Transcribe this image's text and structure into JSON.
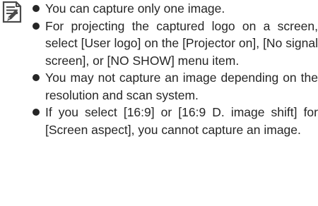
{
  "note": {
    "icon": "note-icon",
    "items": [
      "You can capture only one image.",
      "For projecting the captured logo on a screen, select [User logo] on the [Projector on], [No signal screen], or [NO SHOW] menu item.",
      "You may not capture an image depending on the resolution and scan system.",
      "If you select [16:9] or [16:9 D. image shift] for [Screen aspect], you cannot capture an image."
    ]
  }
}
